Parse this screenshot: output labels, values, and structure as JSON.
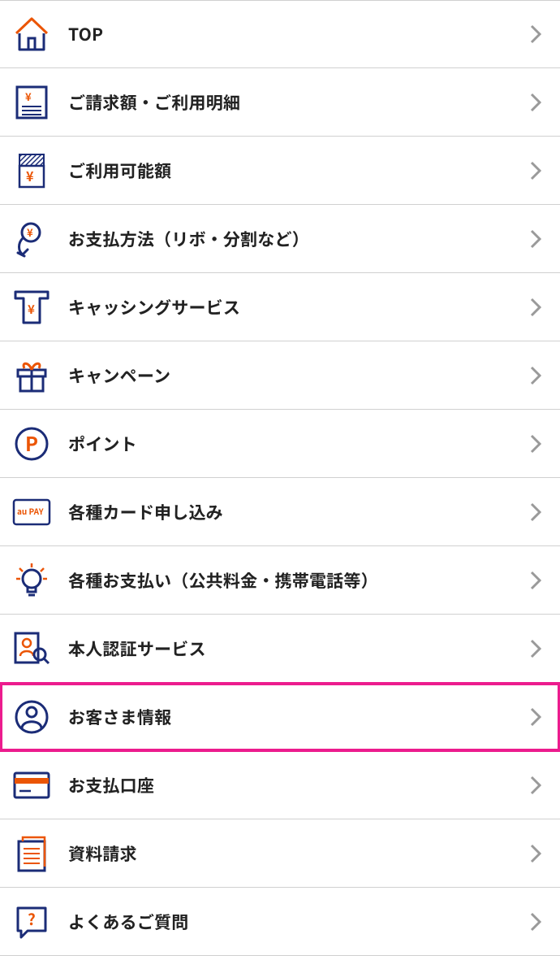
{
  "colors": {
    "orange": "#eb5505",
    "navy": "#1b2c77",
    "gray": "#9a9a9a",
    "pink": "#ec1c8e"
  },
  "menu": {
    "items": [
      {
        "id": "top",
        "label": "TOP",
        "icon": "home-icon",
        "highlighted": false
      },
      {
        "id": "billing",
        "label": "ご請求額・ご利用明細",
        "icon": "statement-icon",
        "highlighted": false
      },
      {
        "id": "credit-limit",
        "label": "ご利用可能額",
        "icon": "credit-limit-icon",
        "highlighted": false
      },
      {
        "id": "payment-method",
        "label": "お支払方法（リボ・分割など）",
        "icon": "payment-method-icon",
        "highlighted": false
      },
      {
        "id": "cashing",
        "label": "キャッシングサービス",
        "icon": "atm-icon",
        "highlighted": false
      },
      {
        "id": "campaign",
        "label": "キャンペーン",
        "icon": "gift-icon",
        "highlighted": false
      },
      {
        "id": "points",
        "label": "ポイント",
        "icon": "point-icon",
        "highlighted": false
      },
      {
        "id": "card-apply",
        "label": "各種カード申し込み",
        "icon": "aupay-card-icon",
        "highlighted": false
      },
      {
        "id": "utility",
        "label": "各種お支払い（公共料金・携帯電話等）",
        "icon": "lightbulb-icon",
        "highlighted": false
      },
      {
        "id": "auth",
        "label": "本人認証サービス",
        "icon": "identity-icon",
        "highlighted": false
      },
      {
        "id": "customer-info",
        "label": "お客さま情報",
        "icon": "profile-icon",
        "highlighted": true
      },
      {
        "id": "bank-account",
        "label": "お支払口座",
        "icon": "bank-card-icon",
        "highlighted": false
      },
      {
        "id": "doc-request",
        "label": "資料請求",
        "icon": "document-icon",
        "highlighted": false
      },
      {
        "id": "faq",
        "label": "よくあるご質問",
        "icon": "faq-icon",
        "highlighted": false
      }
    ]
  },
  "aupay_text": "au PAY"
}
